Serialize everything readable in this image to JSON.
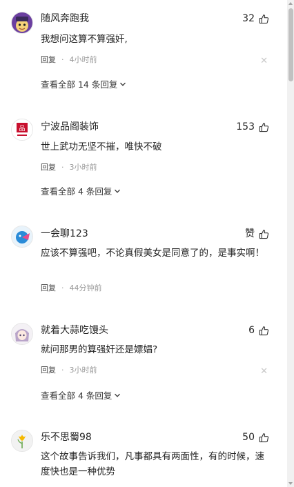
{
  "comments": [
    {
      "username": "随风奔跑我",
      "likes": "32",
      "text": "我想问这算不算强奸,",
      "reply_label": "回复",
      "time": "4小时前",
      "view_all": "查看全部 14 条回复",
      "avatar_icon": "cartoon-face-avatar"
    },
    {
      "username": "宁波品阁装饰",
      "likes": "153",
      "text": "世上武功无坚不摧，唯快不破",
      "reply_label": "回复",
      "time": "3小时前",
      "view_all": "查看全部 4 条回复",
      "avatar_icon": "brand-logo-avatar"
    },
    {
      "username": "一会聊123",
      "likes": "赞",
      "text": "应该不算强吧，不论真假美女是同意了的，是事实啊！",
      "reply_label": "回复",
      "time": "44分钟前",
      "avatar_icon": "blue-bird-avatar"
    },
    {
      "username": "就着大蒜吃馒头",
      "likes": "6",
      "text": "就问那男的算强奸还是嫖娼?",
      "reply_label": "回复",
      "time": "3小时前",
      "view_all": "查看全部 4 条回复",
      "avatar_icon": "anime-character-avatar"
    },
    {
      "username": "乐不思蜀98",
      "likes": "50",
      "text": "这个故事告诉我们，凡事都具有两面性，有的时候，速度快也是一种优势",
      "avatar_icon": "flower-avatar"
    }
  ],
  "colors": {
    "text": "#222222",
    "meta": "#999999",
    "close": "#c8c8c8"
  }
}
